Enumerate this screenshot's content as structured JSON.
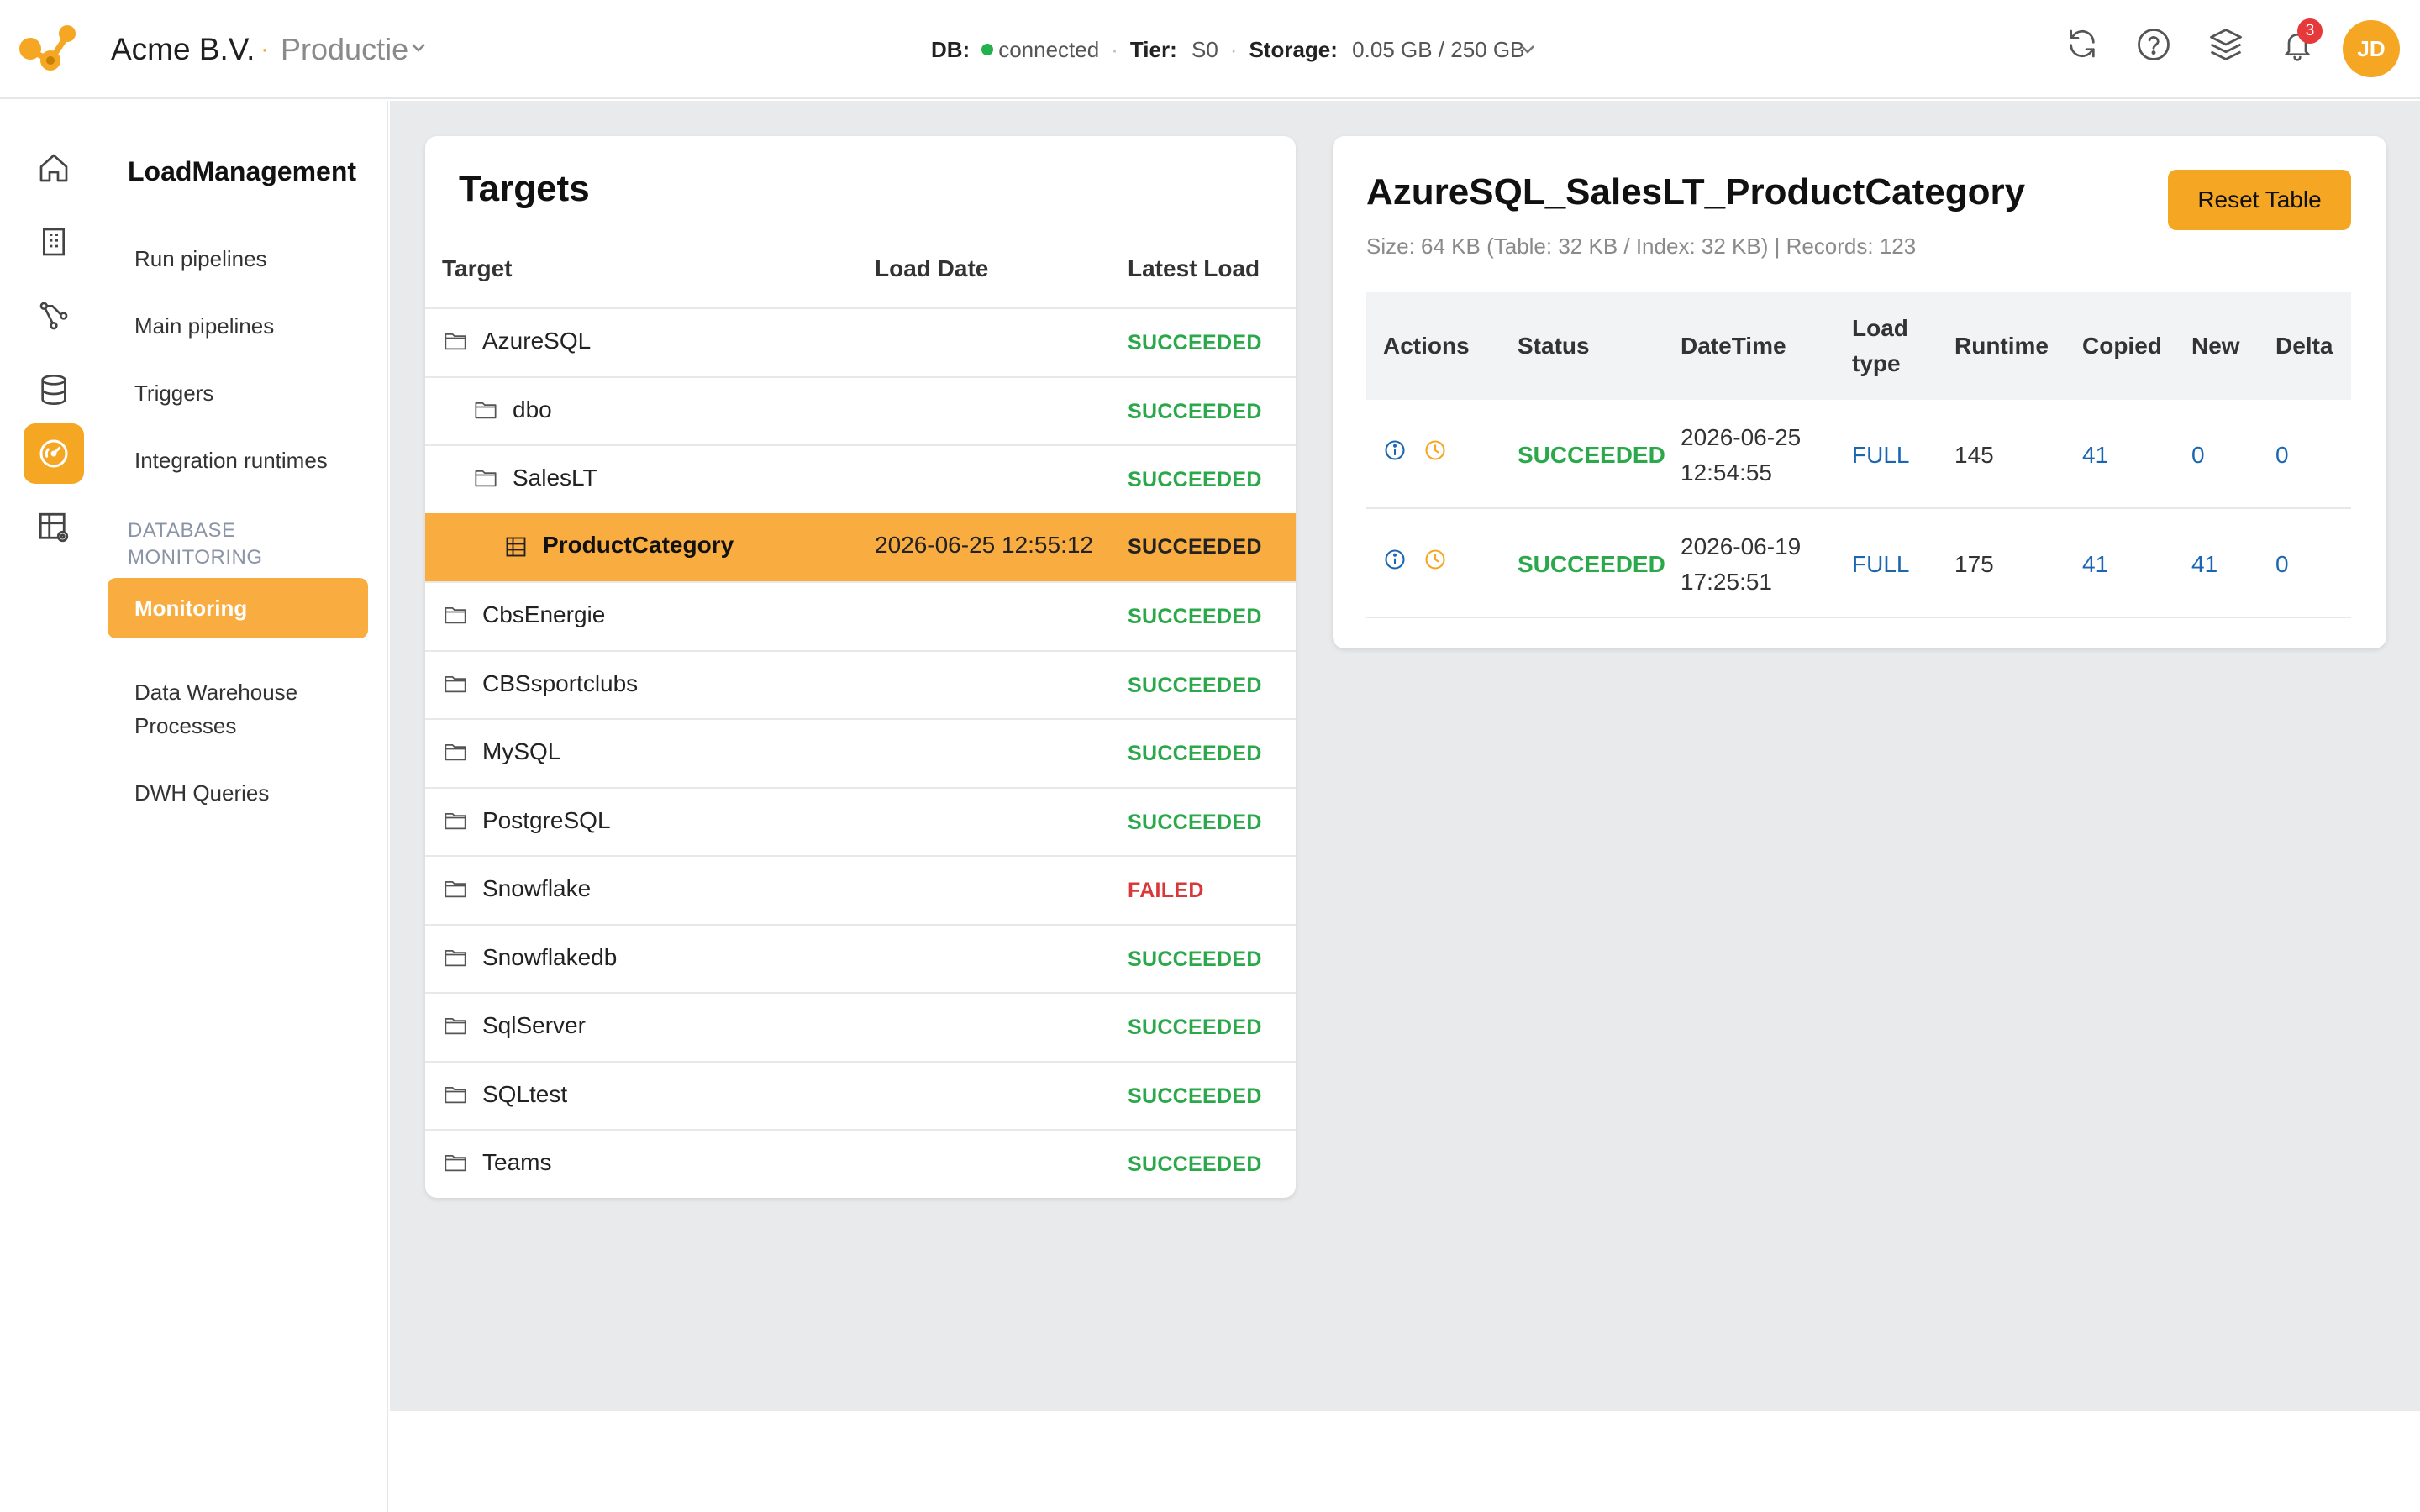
{
  "header": {
    "company": "Acme B.V.",
    "dot": "·",
    "environment": "Productie",
    "db_label": "DB:",
    "db_status": "connected",
    "tier_label": "Tier:",
    "tier_value": "S0",
    "storage_label": "Storage:",
    "storage_value": "0.05 GB / 250 GB",
    "notification_count": "3",
    "avatar_initials": "JD"
  },
  "sidebar": {
    "title": "LoadManagement",
    "items": [
      "Run pipelines",
      "Main pipelines",
      "Triggers",
      "Integration runtimes"
    ],
    "section_line1": "DATABASE",
    "section_line2": "MONITORING",
    "active_item": "Monitoring",
    "items_after": [
      "Data Warehouse",
      "Processes",
      "DWH Queries"
    ]
  },
  "targets": {
    "title": "Targets",
    "columns": [
      "Target",
      "Load Date",
      "Latest Load"
    ],
    "rows": [
      {
        "name": "AzureSQL",
        "load_date": "",
        "status": "SUCCEEDED"
      },
      {
        "name": "dbo",
        "load_date": "",
        "status": "SUCCEEDED"
      },
      {
        "name": "SalesLT",
        "load_date": "",
        "status": "SUCCEEDED"
      },
      {
        "name": "ProductCategory",
        "load_date": "2026-06-25 12:55:12",
        "status": "SUCCEEDED"
      },
      {
        "name": "CbsEnergie",
        "load_date": "",
        "status": "SUCCEEDED"
      },
      {
        "name": "CBSsportclubs",
        "load_date": "",
        "status": "SUCCEEDED"
      },
      {
        "name": "MySQL",
        "load_date": "",
        "status": "SUCCEEDED"
      },
      {
        "name": "PostgreSQL",
        "load_date": "",
        "status": "SUCCEEDED"
      },
      {
        "name": "Snowflake",
        "load_date": "",
        "status": "FAILED"
      },
      {
        "name": "Snowflakedb",
        "load_date": "",
        "status": "SUCCEEDED"
      },
      {
        "name": "SqlServer",
        "load_date": "",
        "status": "SUCCEEDED"
      },
      {
        "name": "SQLtest",
        "load_date": "",
        "status": "SUCCEEDED"
      },
      {
        "name": "Teams",
        "load_date": "",
        "status": "SUCCEEDED"
      }
    ]
  },
  "detail": {
    "title": "AzureSQL_SalesLT_ProductCategory",
    "subtitle": "Size: 64 KB (Table: 32 KB / Index: 32 KB) | Records: 123",
    "reset_label": "Reset Table",
    "columns": {
      "actions": "Actions",
      "status": "Status",
      "datetime": "DateTime",
      "load_type_1": "Load",
      "load_type_2": "type",
      "runtime": "Runtime",
      "copied": "Copied",
      "new": "New",
      "delta": "Delta"
    },
    "rows": [
      {
        "status": "SUCCEEDED",
        "date": "2026-06-25",
        "time": "12:54:55",
        "load_type": "FULL",
        "runtime": "145",
        "copied": "41",
        "new": "0",
        "delta": "0"
      },
      {
        "status": "SUCCEEDED",
        "date": "2026-06-19",
        "time": "17:25:51",
        "load_type": "FULL",
        "runtime": "175",
        "copied": "41",
        "new": "41",
        "delta": "0"
      }
    ]
  },
  "colors": {
    "accent": "#f5a623",
    "success": "#2aa84a",
    "failure": "#d9383a",
    "link": "#1a66b3"
  }
}
